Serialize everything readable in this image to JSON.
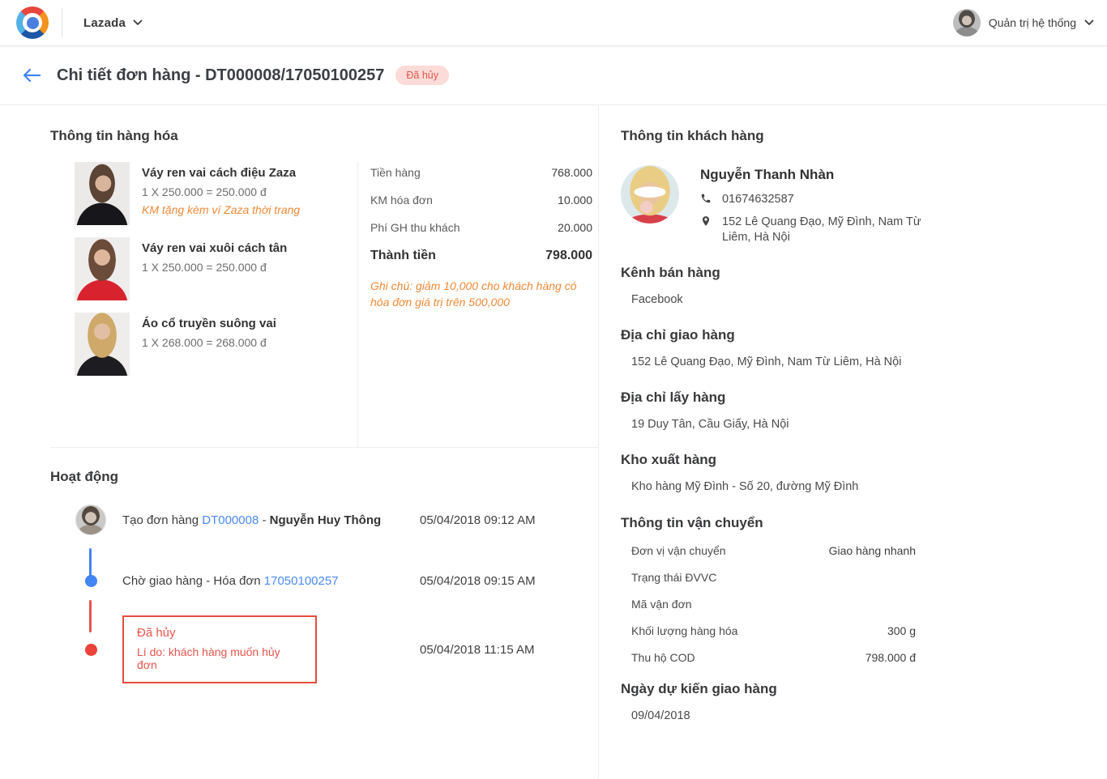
{
  "topbar": {
    "store_name": "Lazada",
    "user_name": "Quản trị hệ thống"
  },
  "header": {
    "title": "Chi tiết đơn hàng - DT000008/17050100257",
    "status_badge": "Đã hủy"
  },
  "goods": {
    "section_title": "Thông tin hàng hóa",
    "products": [
      {
        "name": "Váy ren vai cách điệu Zaza",
        "quantity_line": "1 X 250.000 = 250.000 đ",
        "promo": "KM tặng kèm ví Zaza thời trang"
      },
      {
        "name": "Váy ren vai xuôi cách tân",
        "quantity_line": "1 X 250.000 = 250.000 đ",
        "promo": ""
      },
      {
        "name": "Áo cổ truyền suông vai",
        "quantity_line": "1 X 268.000 = 268.000 đ",
        "promo": ""
      }
    ],
    "totals": {
      "rows": [
        {
          "label": "Tiền hàng",
          "value": "768.000"
        },
        {
          "label": "KM hóa đơn",
          "value": "10.000"
        },
        {
          "label": "Phí GH thu khách",
          "value": "20.000"
        }
      ],
      "total_label": "Thành tiền",
      "total_value": "798.000",
      "note": "Ghi chú: giảm 10,000 cho khách hàng có hóa đơn giá trị trên 500,000"
    }
  },
  "activity": {
    "section_title": "Hoạt động",
    "events": [
      {
        "prefix": "Tạo đơn hàng ",
        "link": "DT000008",
        "separator": " - ",
        "actor": "Nguyễn Huy Thông",
        "time": "05/04/2018 09:12 AM"
      },
      {
        "prefix": "Chờ giao hàng - Hóa đơn ",
        "link": "17050100257",
        "time": "05/04/2018 09:15 AM"
      },
      {
        "title": "Đã hủy",
        "reason": "Lí do: khách hàng muốn hủy đơn",
        "time": "05/04/2018 11:15 AM"
      }
    ]
  },
  "customer": {
    "section_title": "Thông tin khách hàng",
    "name": "Nguyễn Thanh Nhàn",
    "phone": "01674632587",
    "address": "152 Lê Quang Đạo, Mỹ Đình, Nam Từ Liêm, Hà Nội",
    "sales_channel": {
      "title": "Kênh bán hàng",
      "value": "Facebook"
    },
    "shipping_address": {
      "title": "Địa chỉ giao hàng",
      "value": "152 Lê Quang Đạo, Mỹ Đình, Nam Từ Liêm, Hà Nội"
    },
    "pickup_address": {
      "title": "Địa chỉ lấy hàng",
      "value": "19 Duy Tân, Cầu Giấy, Hà Nội"
    },
    "warehouse": {
      "title": "Kho xuất hàng",
      "value": "Kho hàng Mỹ Đình - Số 20, đường Mỹ Đình"
    }
  },
  "shipping": {
    "section_title": "Thông tin vận chuyển",
    "rows": [
      {
        "label": "Đơn vị vận chuyển",
        "value": "Giao hàng nhanh"
      },
      {
        "label": "Trạng thái ĐVVC",
        "value": ""
      },
      {
        "label": "Mã vận đơn",
        "value": ""
      },
      {
        "label": "Khối lượng hàng hóa",
        "value": "300 g"
      },
      {
        "label": "Thu hộ COD",
        "value": "798.000 đ"
      }
    ],
    "expected_delivery": {
      "title": "Ngày dự kiến giao hàng",
      "value": "09/04/2018"
    }
  },
  "colors": {
    "accent_blue": "#4285f4",
    "link_blue": "#4a8af4",
    "accent_orange": "#ef8937",
    "accent_red": "#e8544c",
    "badge_bg": "#fcdbd8"
  }
}
